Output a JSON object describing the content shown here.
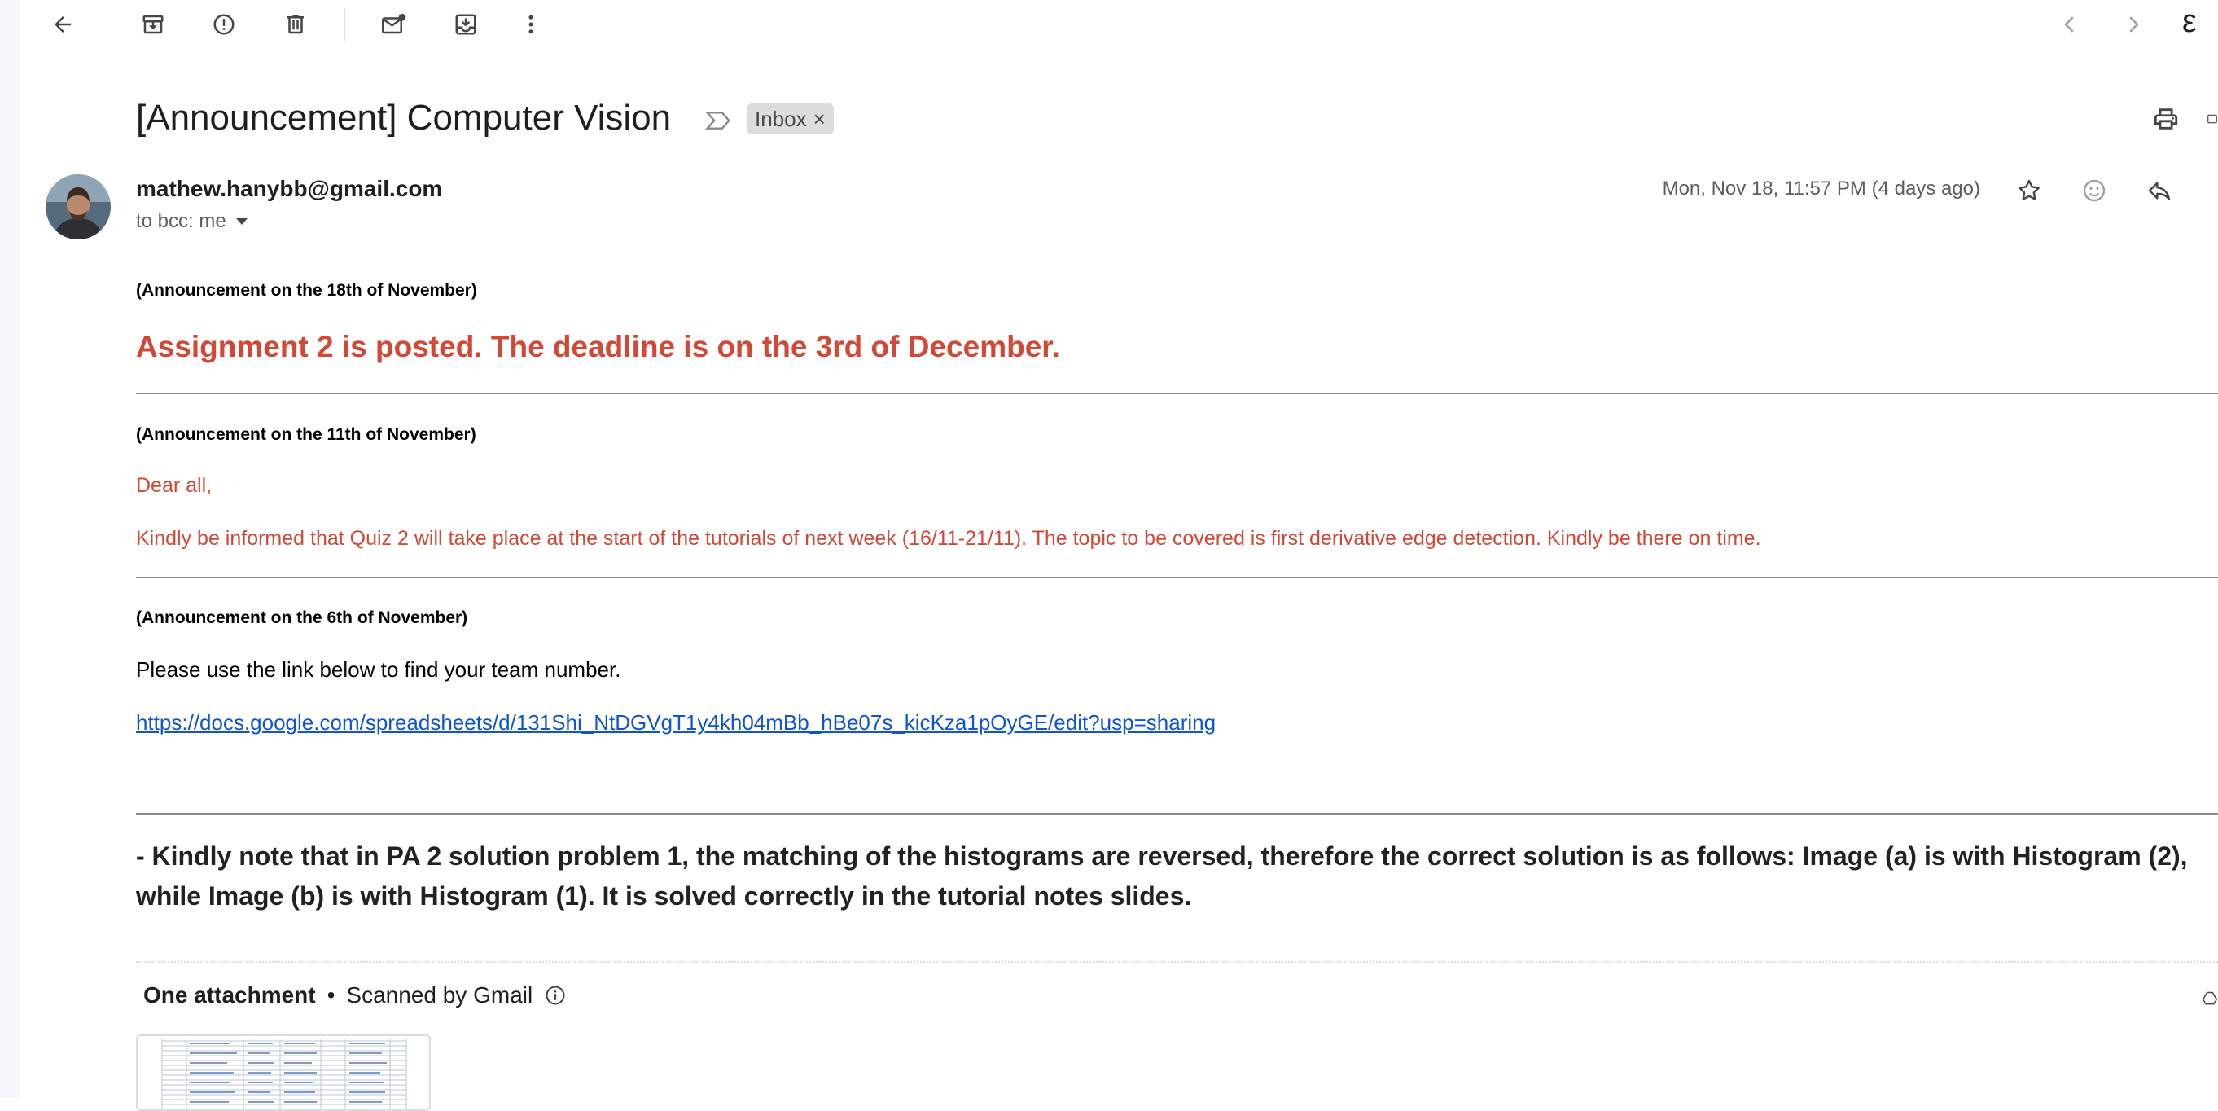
{
  "toolbar": {
    "back": "arrow-left-icon",
    "archive": "archive-icon",
    "report_spam": "report-spam-icon",
    "delete": "trash-icon",
    "mark_unread": "mark-unread-icon",
    "move_to": "move-to-icon",
    "more": "more-vert-icon",
    "prev": "chevron-left-icon",
    "next": "chevron-right-icon",
    "edge_glyph": "ε"
  },
  "email": {
    "subject": "[Announcement] Computer Vision",
    "label_chip": "Inbox",
    "label_chip_close": "×",
    "sender": "mathew.hanybb@gmail.com",
    "recipients": "to bcc: me",
    "date": "Mon, Nov 18, 11:57 PM (4 days ago)"
  },
  "body": {
    "ann1_header": "(Announcement on the 18th of November)",
    "ann1_text": "Assignment 2 is posted. The deadline is on the 3rd of December.",
    "ann2_header": "(Announcement on the 11th of November)",
    "ann2_greeting": "Dear all,",
    "ann2_text": "Kindly be informed that Quiz 2 will take place at the start of the tutorials of next week (16/11-21/11). The topic to be covered is first derivative edge detection. Kindly be there on time.",
    "ann3_header": "(Announcement on the 6th of November)",
    "ann3_text": "Please use the link below to find your team number.",
    "ann3_link": "https://docs.google.com/spreadsheets/d/131Shi_NtDGVgT1y4kh04mBb_hBe07s_kicKza1pOyGE/edit?usp=sharing",
    "note": "- Kindly note that in PA 2 solution problem 1, the matching of the histograms are reversed, therefore the correct solution is as follows: Image (a) is with Histogram (2), while Image (b) is with Histogram (1). It is solved correctly in the tutorial notes slides."
  },
  "attachments": {
    "title": "One attachment",
    "separator": "•",
    "scanned": "Scanned by Gmail"
  },
  "colors": {
    "announcement_red": "#d14836",
    "link_blue": "#1155cc",
    "chip_bg": "#dddddd"
  }
}
